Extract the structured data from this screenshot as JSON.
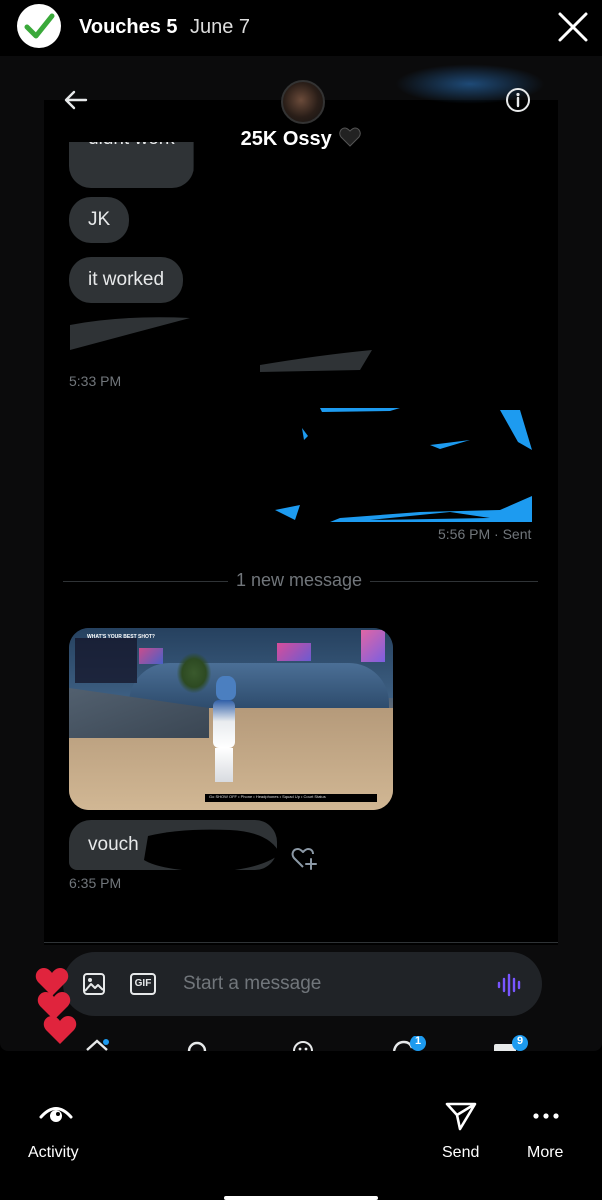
{
  "story": {
    "title": "Vouches 5",
    "date": "June 7"
  },
  "screenshot": {
    "contact_name": "25K Ossy",
    "messages": [
      {
        "text": "didnt work"
      },
      {
        "text": "JK"
      },
      {
        "text": "it worked"
      }
    ],
    "time_1": "5:33 PM",
    "time_sent": "5:56 PM · Sent",
    "divider": "1 new message",
    "game_text": {
      "title": "WHAT'S YOUR BEST SHOT?",
      "hud": "Go SHOW OFF • Phone • Headphones • Squad Up • Court Status"
    },
    "vouch_text": "vouch",
    "time_2": "6:35 PM",
    "composer_placeholder": "Start a message",
    "gif_label": "GIF",
    "notif_badge": "1",
    "msg_badge": "9"
  },
  "bottom_bar": {
    "activity_label": "Activity",
    "send_label": "Send",
    "more_label": "More"
  },
  "colors": {
    "accent_blue": "#1d9bf0",
    "bubble_gray": "#2f3336",
    "heart_red": "#e0243d",
    "voice_purple": "#7856ff"
  }
}
